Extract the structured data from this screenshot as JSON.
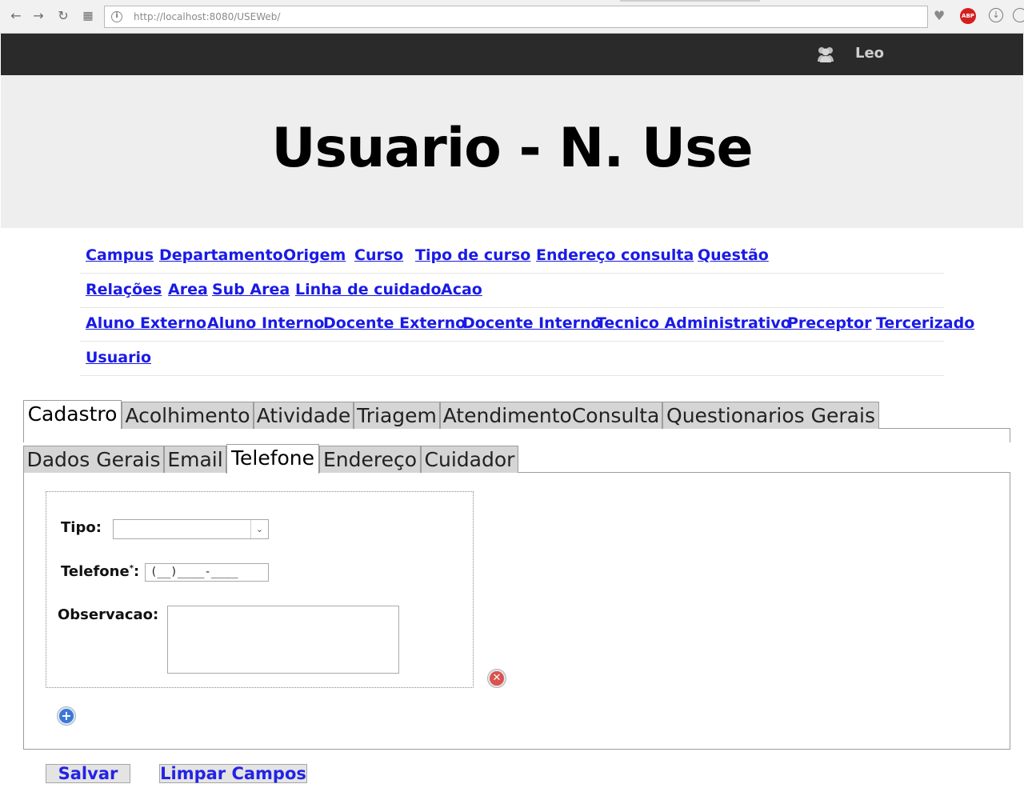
{
  "browser": {
    "url": "http://localhost:8080/USEWeb/",
    "abp_label": "ABP"
  },
  "header": {
    "user_name": "Leo"
  },
  "hero": {
    "title": "Usuario - N. Use"
  },
  "nav": {
    "row1": [
      "Campus",
      "Departamento",
      "Origem",
      "Curso",
      "Tipo de curso",
      "Endereço consulta",
      "Questão"
    ],
    "row2": [
      "Relações",
      "Area",
      "Sub Area",
      "Linha de cuidado",
      "Acao"
    ],
    "row3": [
      "Aluno Externo",
      "Aluno Interno",
      "Docente Externo",
      "Docente Interno",
      "Tecnico Administrativo",
      "Preceptor",
      "Tercerizado"
    ],
    "row4": [
      "Usuario"
    ]
  },
  "main_tabs": [
    "Cadastro",
    "Acolhimento",
    "Atividade",
    "Triagem",
    "AtendimentoConsulta",
    "Questionarios Gerais"
  ],
  "main_tab_active": "Cadastro",
  "sub_tabs": [
    "Dados Gerais",
    "Email",
    "Telefone",
    "Endereço",
    "Cuidador"
  ],
  "sub_tab_active": "Telefone",
  "form": {
    "tipo_label": "Tipo:",
    "tipo_value": "",
    "telefone_label": "Telefone",
    "telefone_required": "*",
    "telefone_colon": ":",
    "telefone_mask": "(__)____-____",
    "observacao_label": "Observacao:",
    "observacao_value": ""
  },
  "icons": {
    "remove": "remove-circle-icon",
    "add": "add-circle-icon",
    "user": "users-icon"
  },
  "buttons": {
    "save": "Salvar",
    "clear": "Limpar Campos"
  }
}
